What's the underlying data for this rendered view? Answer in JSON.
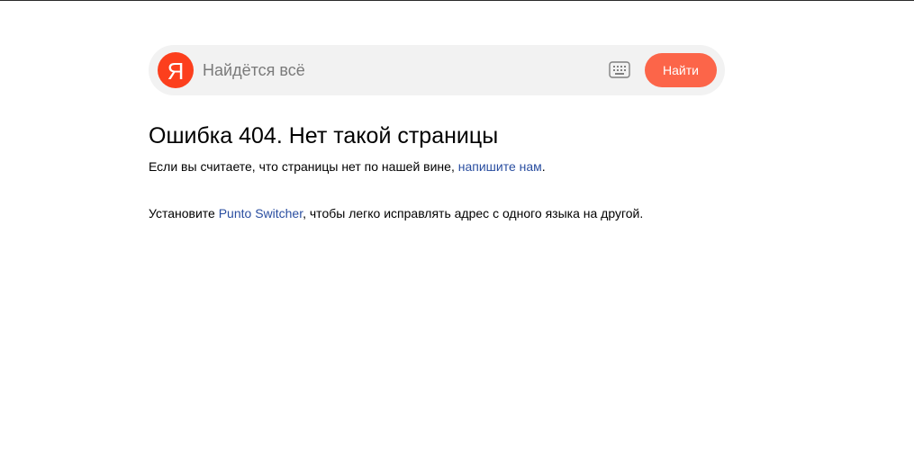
{
  "search": {
    "logo_letter": "Я",
    "placeholder": "Найдётся всё",
    "value": "",
    "button_label": "Найти",
    "keyboard_icon": "keyboard-icon"
  },
  "error": {
    "title": "Ошибка 404. Нет такой страницы",
    "report_text_before": "Если вы считаете, что страницы нет по нашей вине, ",
    "report_link": "напишите нам",
    "report_text_after": ".",
    "punto_text_before": "Установите ",
    "punto_link": "Punto Switcher",
    "punto_text_after": ", чтобы легко исправлять адрес с одного языка на другой."
  },
  "colors": {
    "brand_red": "#fc3f1d",
    "button": "#fc6549",
    "link": "#2a4ea0",
    "search_bg": "#f2f2f2"
  }
}
